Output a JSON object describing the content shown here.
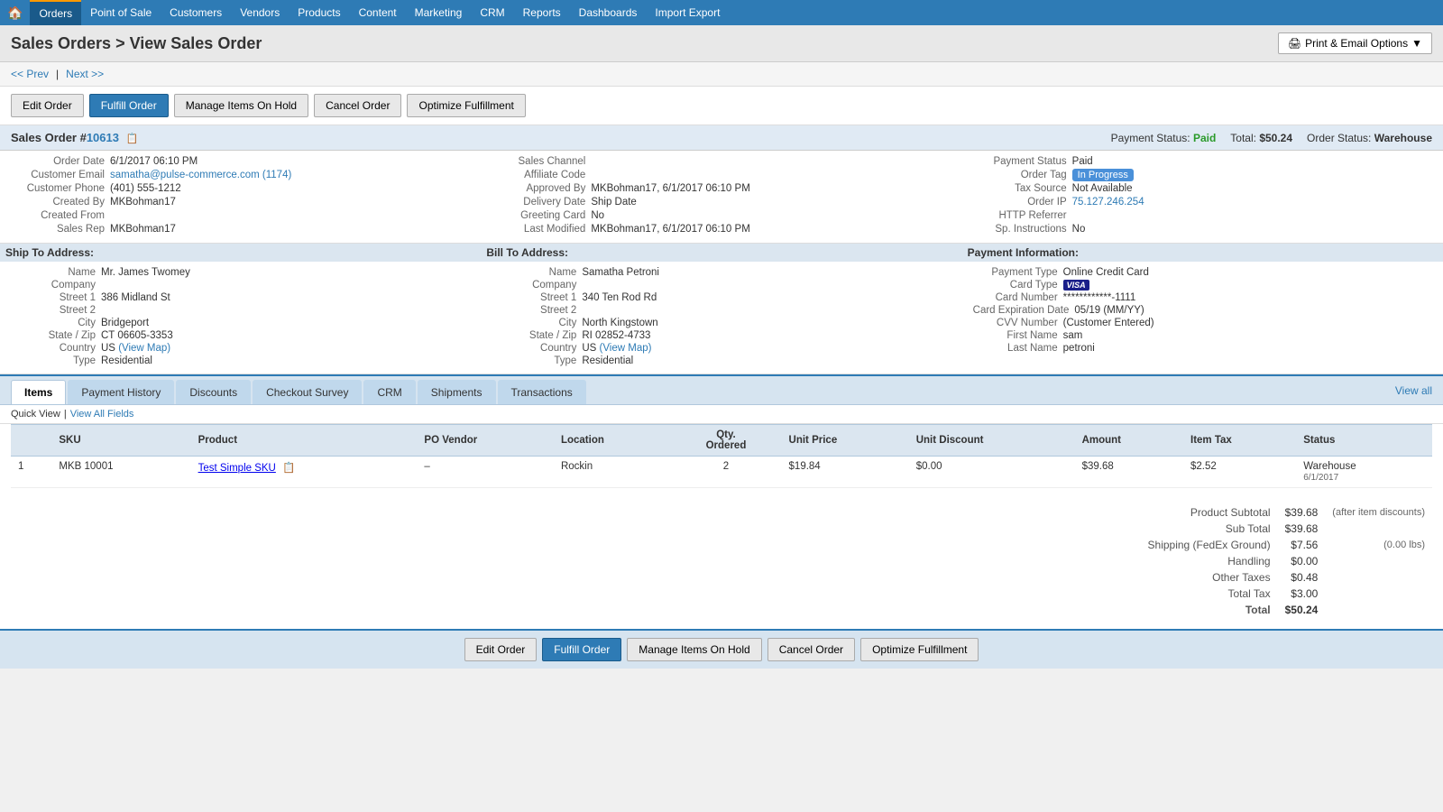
{
  "nav": {
    "items": [
      "Home",
      "Orders",
      "Point of Sale",
      "Customers",
      "Vendors",
      "Products",
      "Content",
      "Marketing",
      "CRM",
      "Reports",
      "Dashboards",
      "Import Export"
    ]
  },
  "header": {
    "title": "Sales Orders > View Sales Order",
    "print_btn": "Print & Email Options"
  },
  "breadcrumb": {
    "prev": "<< Prev",
    "next": "Next >>"
  },
  "action_buttons": {
    "edit_order": "Edit Order",
    "fulfill_order": "Fulfill Order",
    "manage_hold": "Manage Items On Hold",
    "cancel_order": "Cancel Order",
    "optimize": "Optimize Fulfillment"
  },
  "order": {
    "id_label": "Sales Order #",
    "id": "10613",
    "payment_status_label": "Payment Status:",
    "payment_status": "Paid",
    "total_label": "Total:",
    "total": "$50.24",
    "order_status_label": "Order Status:",
    "order_status": "Warehouse"
  },
  "order_details": {
    "order_date_label": "Order Date",
    "order_date": "6/1/2017 06:10 PM",
    "sales_channel_label": "Sales Channel",
    "sales_channel": "",
    "payment_status_label": "Payment Status",
    "payment_status": "Paid",
    "customer_email_label": "Customer Email",
    "customer_email": "samatha@pulse-commerce.com",
    "customer_email_count": "(1174)",
    "affiliate_code_label": "Affiliate Code",
    "affiliate_code": "",
    "order_tag_label": "Order Tag",
    "order_tag": "In Progress",
    "customer_phone_label": "Customer Phone",
    "customer_phone": "(401) 555-1212",
    "approved_by_label": "Approved By",
    "approved_by": "MKBohman17, 6/1/2017 06:10 PM",
    "tax_source_label": "Tax Source",
    "tax_source": "Not Available",
    "created_by_label": "Created By",
    "created_by": "MKBohman17",
    "delivery_date_label": "Delivery Date",
    "delivery_date": "Ship Date",
    "order_ip_label": "Order IP",
    "order_ip": "75.127.246.254",
    "created_from_label": "Created From",
    "created_from": "",
    "greeting_card_label": "Greeting Card",
    "greeting_card": "No",
    "http_referrer_label": "HTTP Referrer",
    "http_referrer": "",
    "sales_rep_label": "Sales Rep",
    "sales_rep": "MKBohman17",
    "last_modified_label": "Last Modified",
    "last_modified": "MKBohman17, 6/1/2017 06:10 PM",
    "sp_instructions_label": "Sp. Instructions",
    "sp_instructions": "No"
  },
  "ship_to": {
    "header": "Ship To Address:",
    "name_label": "Name",
    "name": "Mr. James Twomey",
    "company_label": "Company",
    "company": "",
    "street1_label": "Street 1",
    "street1": "386 Midland St",
    "street2_label": "Street 2",
    "street2": "",
    "city_label": "City",
    "city": "Bridgeport",
    "state_zip_label": "State / Zip",
    "state_zip": "CT 06605-3353",
    "country_label": "Country",
    "country": "US",
    "view_map": "(View Map)",
    "type_label": "Type",
    "type": "Residential"
  },
  "bill_to": {
    "header": "Bill To Address:",
    "name_label": "Name",
    "name": "Samatha Petroni",
    "company_label": "Company",
    "company": "",
    "street1_label": "Street 1",
    "street1": "340 Ten Rod Rd",
    "street2_label": "Street 2",
    "street2": "",
    "city_label": "City",
    "city": "North Kingstown",
    "state_zip_label": "State / Zip",
    "state_zip": "RI 02852-4733",
    "country_label": "Country",
    "country": "US",
    "view_map": "(View Map)",
    "type_label": "Type",
    "type": "Residential"
  },
  "payment_info": {
    "header": "Payment Information:",
    "payment_type_label": "Payment Type",
    "payment_type": "Online Credit Card",
    "card_type_label": "Card Type",
    "card_type": "VISA",
    "card_number_label": "Card Number",
    "card_number": "************-1111",
    "card_expiry_label": "Card Expiration Date",
    "card_expiry": "05/19 (MM/YY)",
    "cvv_label": "CVV Number",
    "cvv": "(Customer Entered)",
    "first_name_label": "First Name",
    "first_name": "sam",
    "last_name_label": "Last Name",
    "last_name": "petroni"
  },
  "tabs": {
    "items": "Items",
    "payment_history": "Payment History",
    "discounts": "Discounts",
    "checkout_survey": "Checkout Survey",
    "crm": "CRM",
    "shipments": "Shipments",
    "transactions": "Transactions",
    "view_all": "View all"
  },
  "quick_view": {
    "label": "Quick View",
    "view_all_fields": "View All Fields"
  },
  "table": {
    "columns": [
      "",
      "SKU",
      "Product",
      "PO Vendor",
      "Location",
      "Qty. Ordered",
      "Unit Price",
      "Unit Discount",
      "Amount",
      "Item Tax",
      "Status"
    ],
    "rows": [
      {
        "num": "1",
        "sku": "MKB 10001",
        "product": "Test Simple SKU",
        "po_vendor": "–",
        "location": "Rockin",
        "qty": "2",
        "unit_price": "$19.84",
        "unit_discount": "$0.00",
        "amount": "$39.68",
        "item_tax": "$2.52",
        "status": "Warehouse",
        "status_date": "6/1/2017"
      }
    ]
  },
  "totals": {
    "product_subtotal_label": "Product Subtotal",
    "product_subtotal": "$39.68",
    "product_subtotal_note": "(after item discounts)",
    "subtotal_label": "Sub Total",
    "subtotal": "$39.68",
    "shipping_label": "Shipping (FedEx Ground)",
    "shipping": "$7.56",
    "shipping_note": "(0.00 lbs)",
    "handling_label": "Handling",
    "handling": "$0.00",
    "other_taxes_label": "Other Taxes",
    "other_taxes": "$0.48",
    "total_tax_label": "Total Tax",
    "total_tax": "$3.00",
    "total_label": "Total",
    "total": "$50.24"
  }
}
